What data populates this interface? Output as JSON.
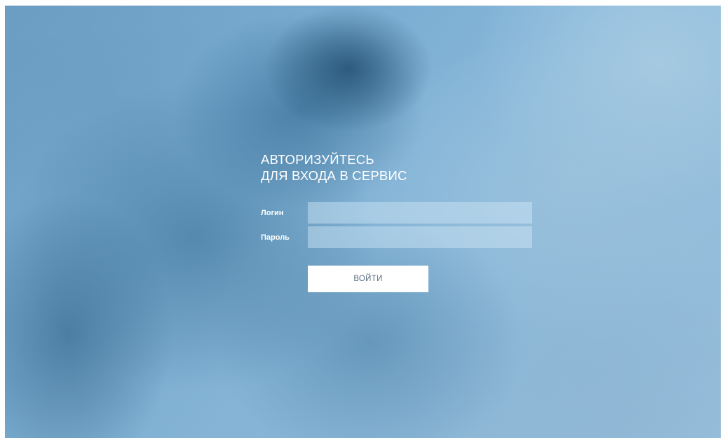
{
  "login_form": {
    "title_line1": "АВТОРИЗУЙТЕСЬ",
    "title_line2": "ДЛЯ ВХОДА В СЕРВИС",
    "login_label": "Логин",
    "login_value": "",
    "password_label": "Пароль",
    "password_value": "",
    "submit_label": "ВОЙТИ"
  },
  "colors": {
    "background_accent": "#7fb0d3",
    "text": "#ffffff",
    "button_background": "#ffffff",
    "button_text": "#5a6e80"
  }
}
